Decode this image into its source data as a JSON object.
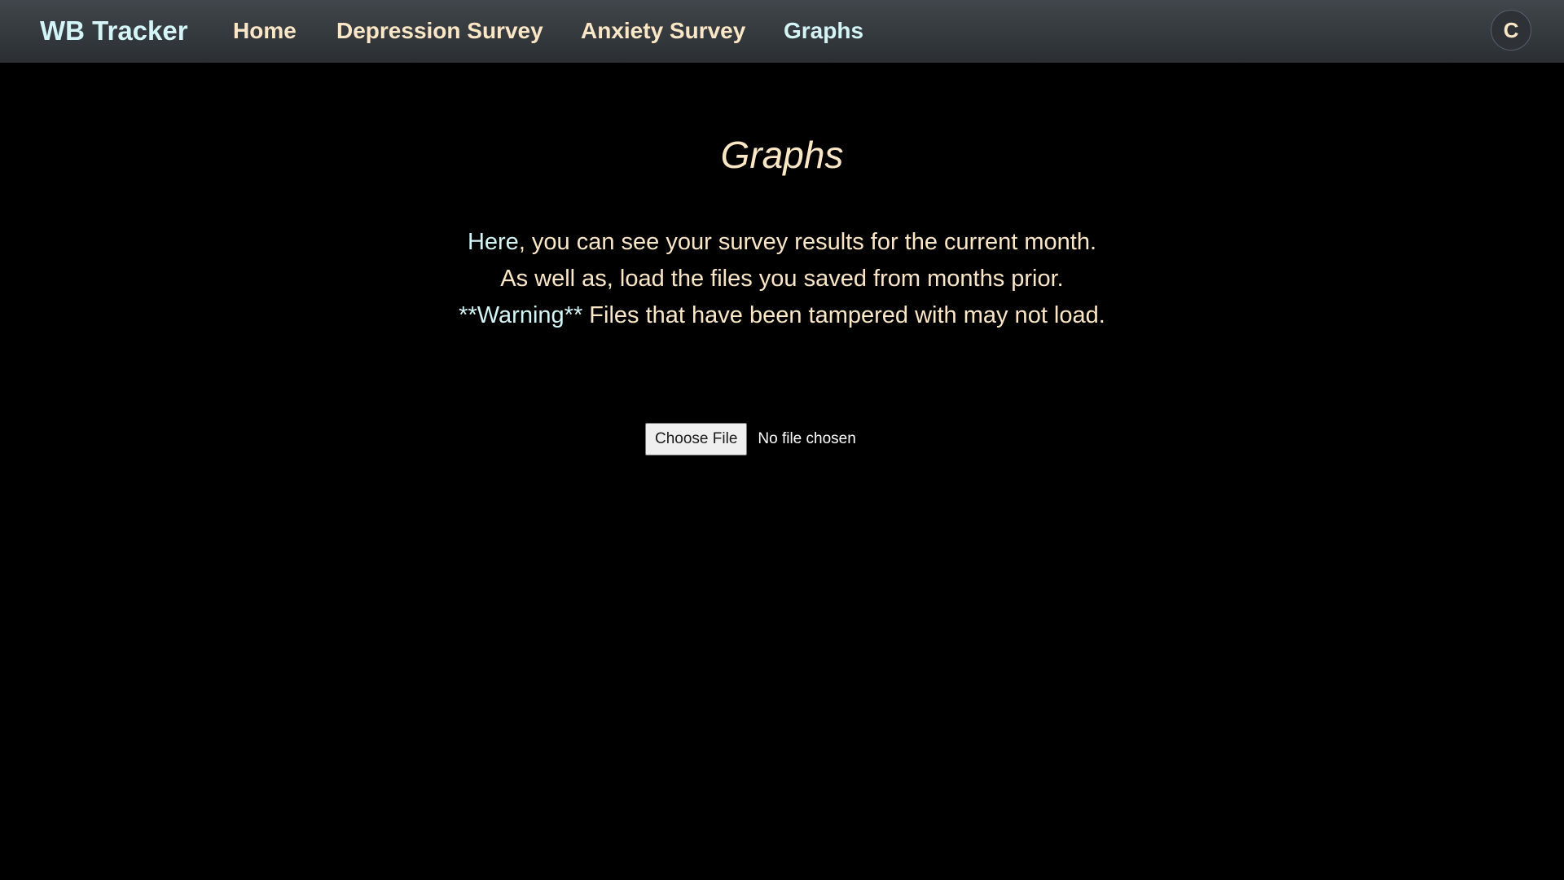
{
  "nav": {
    "brand": "WB Tracker",
    "links": [
      {
        "label": "Home"
      },
      {
        "label": "Depression Survey"
      },
      {
        "label": "Anxiety Survey"
      },
      {
        "label": "Graphs"
      }
    ],
    "active": "Graphs",
    "avatar_initial": "C"
  },
  "main": {
    "title": "Graphs",
    "intro": {
      "line1_accent": "Here",
      "line1_rest": ", you can see your survey results for the current month.",
      "line2": "As well as, load the files you saved from months prior.",
      "line3_accent": "**Warning**",
      "line3_rest": " Files that have been tampered with may not load."
    },
    "file_input": {
      "button_label": "Choose File",
      "status": "No file chosen"
    }
  },
  "colors": {
    "background": "#000000",
    "navbar": "#2b2f33",
    "accent": "#d4f5f8",
    "text": "#fbe7c6"
  }
}
